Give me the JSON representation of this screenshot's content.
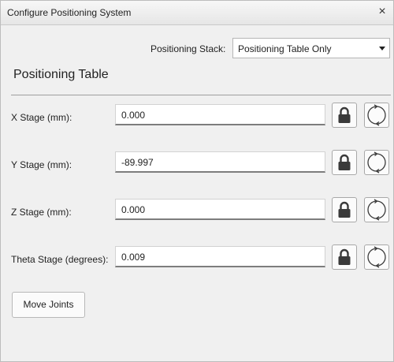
{
  "window": {
    "title": "Configure Positioning System",
    "close_glyph": "×"
  },
  "stack": {
    "label": "Positioning Stack:",
    "selected": "Positioning Table Only"
  },
  "section": {
    "title": "Positioning Table"
  },
  "stages": [
    {
      "label": "X Stage (mm):",
      "value": "0.000",
      "lock_icon": "lock-icon",
      "sync_icon": "refresh-icon"
    },
    {
      "label": "Y Stage (mm):",
      "value": "-89.997",
      "lock_icon": "lock-icon",
      "sync_icon": "refresh-icon"
    },
    {
      "label": "Z Stage (mm):",
      "value": "0.000",
      "lock_icon": "lock-icon",
      "sync_icon": "refresh-icon"
    },
    {
      "label": "Theta Stage (degrees):",
      "value": "0.009",
      "lock_icon": "lock-icon",
      "sync_icon": "refresh-icon"
    }
  ],
  "actions": {
    "move_joints": "Move Joints"
  },
  "colors": {
    "background": "#f0f0f0",
    "field_border": "#7d7d7d",
    "icon": "#3a3a3a"
  }
}
